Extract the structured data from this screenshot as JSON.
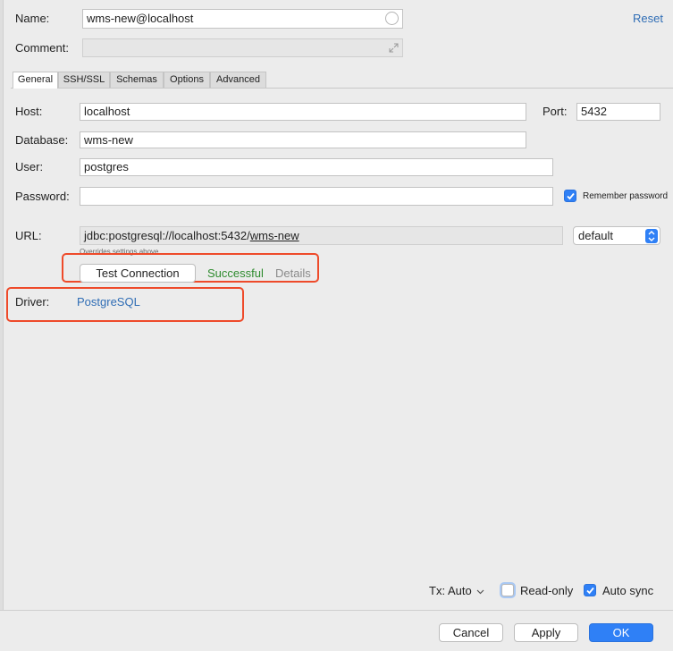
{
  "name_label": "Name:",
  "name_value": "wms-new@localhost",
  "reset_link": "Reset",
  "comment_label": "Comment:",
  "comment_value": "",
  "tabs": [
    {
      "label": "General",
      "active": true
    },
    {
      "label": "SSH/SSL",
      "active": false
    },
    {
      "label": "Schemas",
      "active": false
    },
    {
      "label": "Options",
      "active": false
    },
    {
      "label": "Advanced",
      "active": false
    }
  ],
  "host_label": "Host:",
  "host_value": "localhost",
  "port_label": "Port:",
  "port_value": "5432",
  "database_label": "Database:",
  "database_value": "wms-new",
  "user_label": "User:",
  "user_value": "postgres",
  "password_label": "Password:",
  "password_value": "",
  "remember_password": {
    "label": "Remember password",
    "checked": true
  },
  "url_label": "URL:",
  "url_prefix": "jdbc:postgresql://localhost:5432/",
  "url_db": "wms-new",
  "url_mode": "default",
  "overrides_note": "Overrides settings above",
  "test_connection_button": "Test Connection",
  "test_status": "Successful",
  "details_link": "Details",
  "driver_label": "Driver:",
  "driver_value": "PostgreSQL",
  "tx_label": "Tx: Auto",
  "read_only": {
    "label": "Read-only",
    "checked": false
  },
  "auto_sync": {
    "label": "Auto sync",
    "checked": true
  },
  "cancel_button": "Cancel",
  "apply_button": "Apply",
  "ok_button": "OK",
  "colors": {
    "accent": "#2f80f6",
    "link": "#2f6db5",
    "success": "#2e8b2e",
    "highlight": "#ee4a2a"
  }
}
